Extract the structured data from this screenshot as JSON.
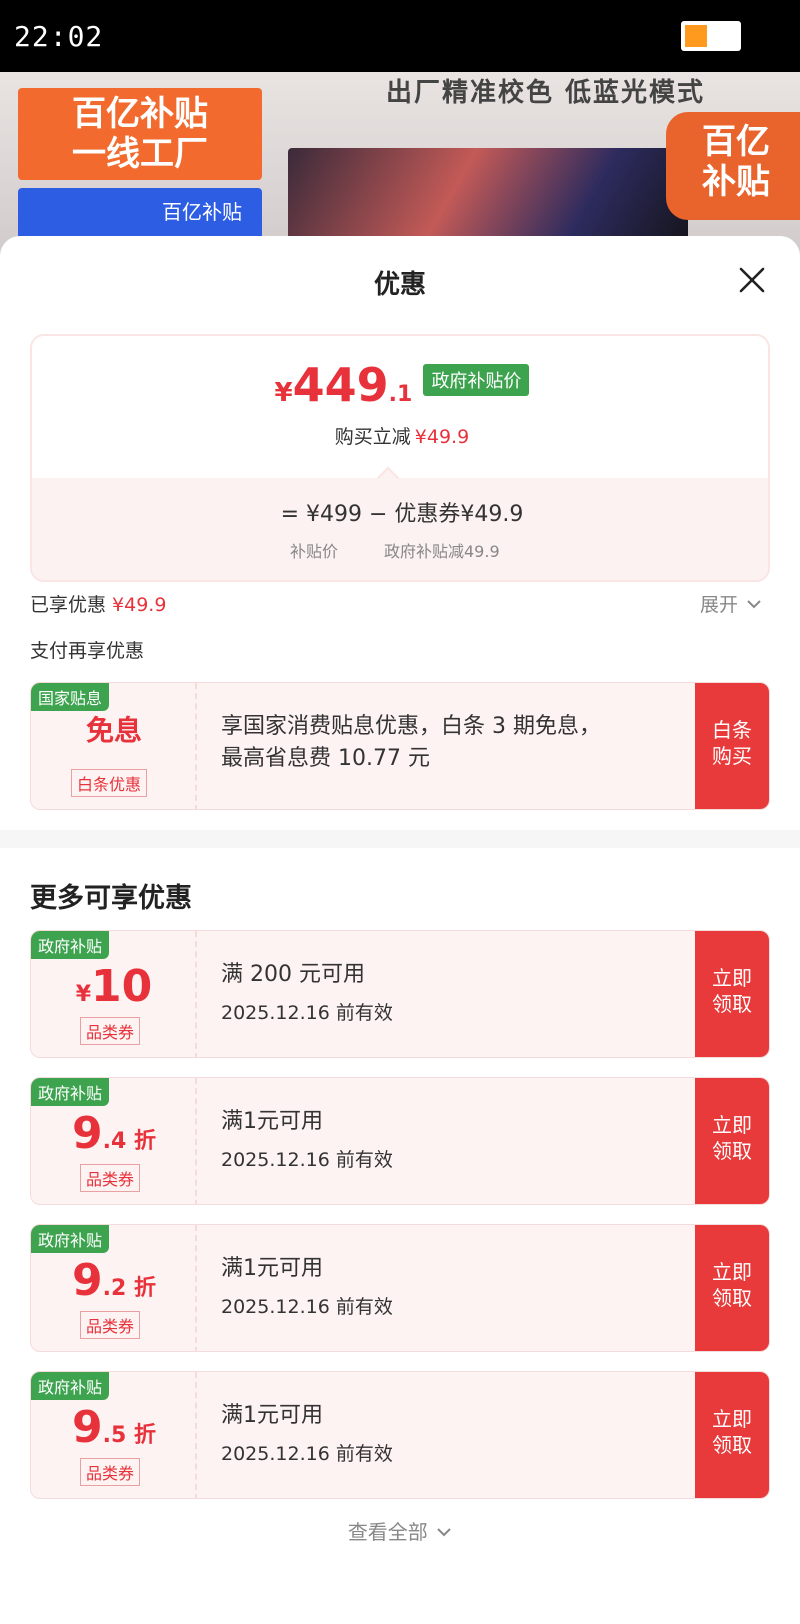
{
  "status_bar": {
    "time": "22:02"
  },
  "background": {
    "promo_line1": "百亿补贴",
    "promo_line2": "一线工厂",
    "promo_small": "百亿补贴",
    "tagline": "出厂精准校色 低蓝光模式",
    "seal_line1": "百亿",
    "seal_line2": "补贴"
  },
  "sheet": {
    "title": "优惠",
    "price": {
      "yen": "¥",
      "integer": "449",
      "decimal": ".1",
      "tag": "政府补贴价",
      "reduce_label": "购买立减",
      "reduce_value": "¥49.9",
      "formula": "= ¥499 − 优惠券¥49.9",
      "sub_left": "补贴价",
      "sub_right": "政府补贴减49.9"
    },
    "enjoyed_label": "已享优惠",
    "enjoyed_value": "¥49.9",
    "expand_label": "展开",
    "pay_more_label": "支付再享优惠",
    "interest_coupon": {
      "badge": "国家贴息",
      "value": "免息",
      "type": "白条优惠",
      "desc_line1": "享国家消费贴息优惠，白条 3 期免息，",
      "desc_line2": "最高省息费 10.77 元",
      "action_line1": "白条",
      "action_line2": "购买"
    },
    "more_title": "更多可享优惠",
    "coupons": [
      {
        "badge": "政府补贴",
        "prefix": "¥",
        "big": "10",
        "suffix": "",
        "type": "品类券",
        "condition": "满 200 元可用",
        "validity": "2025.12.16 前有效",
        "action_line1": "立即",
        "action_line2": "领取"
      },
      {
        "badge": "政府补贴",
        "prefix": "",
        "big": "9",
        "suffix": ".4 折",
        "type": "品类券",
        "condition": "满1元可用",
        "validity": "2025.12.16 前有效",
        "action_line1": "立即",
        "action_line2": "领取"
      },
      {
        "badge": "政府补贴",
        "prefix": "",
        "big": "9",
        "suffix": ".2 折",
        "type": "品类券",
        "condition": "满1元可用",
        "validity": "2025.12.16 前有效",
        "action_line1": "立即",
        "action_line2": "领取"
      },
      {
        "badge": "政府补贴",
        "prefix": "",
        "big": "9",
        "suffix": ".5 折",
        "type": "品类券",
        "condition": "满1元可用",
        "validity": "2025.12.16 前有效",
        "action_line1": "立即",
        "action_line2": "领取"
      }
    ],
    "view_all": "查看全部"
  }
}
